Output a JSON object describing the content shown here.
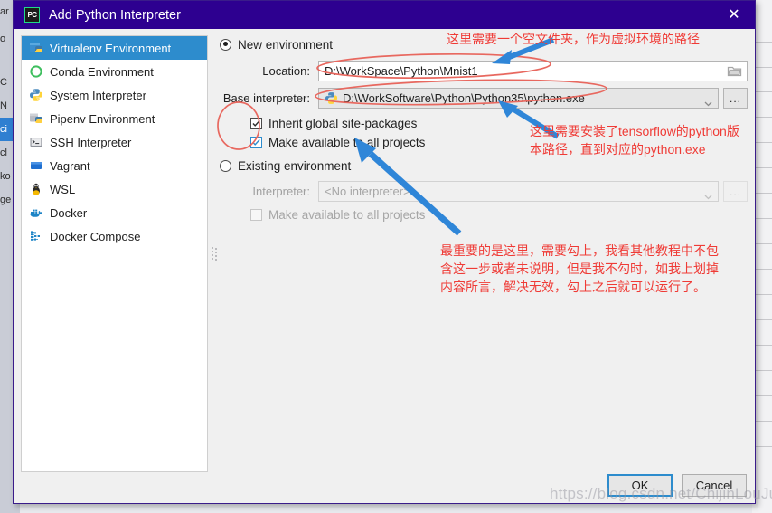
{
  "window": {
    "title": "Add Python Interpreter",
    "app_icon": "pycharm-pc-icon",
    "close_label": "✕",
    "titlebar_color": "#2d0090"
  },
  "sidebar": {
    "items": [
      {
        "label": "Virtualenv Environment",
        "icon": "virtualenv-icon",
        "selected": true
      },
      {
        "label": "Conda Environment",
        "icon": "conda-icon",
        "selected": false
      },
      {
        "label": "System Interpreter",
        "icon": "python-icon",
        "selected": false
      },
      {
        "label": "Pipenv Environment",
        "icon": "pipenv-icon",
        "selected": false
      },
      {
        "label": "SSH Interpreter",
        "icon": "terminal-icon",
        "selected": false
      },
      {
        "label": "Vagrant",
        "icon": "vagrant-icon",
        "selected": false
      },
      {
        "label": "WSL",
        "icon": "linux-tux-icon",
        "selected": false
      },
      {
        "label": "Docker",
        "icon": "docker-icon",
        "selected": false
      },
      {
        "label": "Docker Compose",
        "icon": "docker-compose-icon",
        "selected": false
      }
    ]
  },
  "form": {
    "new_environment": {
      "radio_label": "New environment",
      "selected": true,
      "location": {
        "label": "Location:",
        "value": "D:\\WorkSpace\\Python\\Mnist1",
        "browse_icon": "folder-icon"
      },
      "base_interpreter": {
        "label": "Base interpreter:",
        "value": "D:\\WorkSoftware\\Python\\Python35\\python.exe",
        "icon": "python-icon",
        "dropdown_icon": "chevron-down-icon",
        "more_button": "..."
      },
      "inherit_globals": {
        "label": "Inherit global site-packages",
        "checked": true
      },
      "make_available": {
        "label": "Make available to all projects",
        "checked": true
      }
    },
    "existing_environment": {
      "radio_label": "Existing environment",
      "selected": false,
      "interpreter": {
        "label": "Interpreter:",
        "value": "<No interpreter>",
        "dropdown_icon": "chevron-down-icon",
        "more_button": "..."
      },
      "make_available": {
        "label": "Make available to all projects",
        "checked": false
      }
    }
  },
  "footer": {
    "ok_label": "OK",
    "cancel_label": "Cancel"
  },
  "annotations": {
    "color": "#ef3b36",
    "location_note": "这里需要一个空文件夹，作为虚拟环境的路径",
    "base_interpreter_note_line1": "这里需要安装了tensorflow的python版",
    "base_interpreter_note_line2": "本路径，直到对应的python.exe",
    "checkbox_note_line1": "最重要的是这里，需要勾上，我看其他教程中不包",
    "checkbox_note_line2": "含这一步或者未说明，但是我不勾时，如我上划掉",
    "checkbox_note_line3": "内容所言，解决无效，勾上之后就可以运行了。"
  },
  "watermark": {
    "text": "https://blog.csdn.net/ChijinLouJue"
  },
  "background": {
    "left_strip_items": [
      "ar",
      "o",
      "C",
      "N",
      "ci",
      "cl",
      "ko",
      "ge"
    ]
  }
}
